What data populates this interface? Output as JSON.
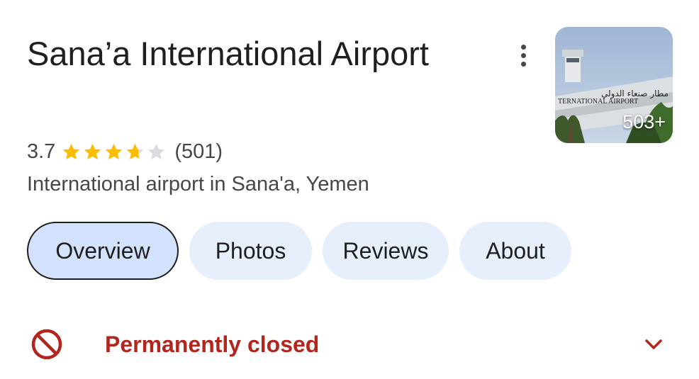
{
  "place": {
    "name": "Sana’a International Airport",
    "rating": "3.7",
    "rating_stars": 3.7,
    "review_count": "(501)",
    "category": "International airport in Sana'a, Yemen"
  },
  "photo": {
    "count_label": "503+",
    "sign_latin": "TERNATIONAL AIRPORT",
    "sign_arabic": "مطار صنعاء الدولي"
  },
  "tabs": [
    {
      "label": "Overview",
      "active": true
    },
    {
      "label": "Photos",
      "active": false
    },
    {
      "label": "Reviews",
      "active": false
    },
    {
      "label": "About",
      "active": false
    }
  ],
  "status": {
    "label": "Permanently closed",
    "icon": "prohibited-icon"
  },
  "icons": {
    "more": "more-vert-icon",
    "expand": "chevron-down-icon"
  },
  "colors": {
    "star": "#fbbc04",
    "star_empty": "#dadce0",
    "closed": "#b3261e",
    "tab_bg": "#e8effc",
    "tab_active_bg": "#d3e3fd"
  }
}
